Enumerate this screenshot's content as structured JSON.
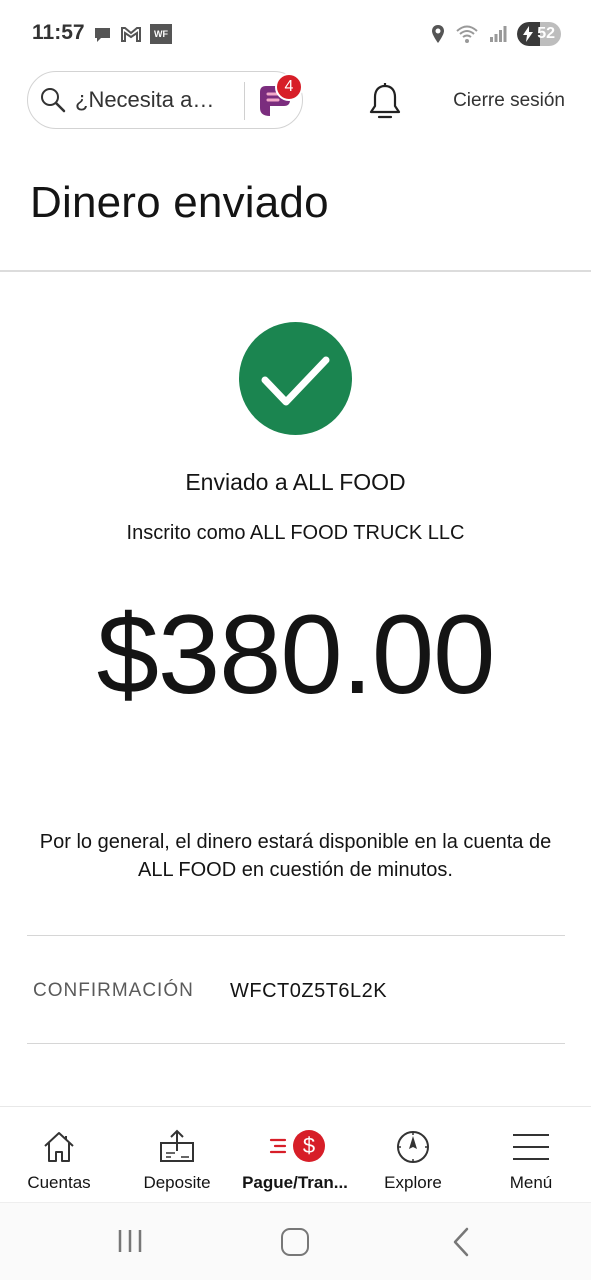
{
  "status_bar": {
    "time": "11:57",
    "wf_badge": "WF",
    "battery_level": "52",
    "icons": [
      "chat-icon",
      "gmail-icon",
      "wf-app-icon",
      "location-icon",
      "wifi-icon",
      "signal-icon",
      "battery-icon"
    ]
  },
  "header": {
    "search_placeholder": "¿Necesita a…",
    "assistant_badge_count": "4",
    "logout_label": "Cierre sesión"
  },
  "page": {
    "title": "Dinero enviado"
  },
  "confirmation": {
    "sent_to": "Enviado a ALL FOOD",
    "registered_as": "Inscrito como ALL FOOD TRUCK LLC",
    "amount": "$380.00",
    "availability_note": "Por lo general, el dinero estará disponible en la cuenta de ALL FOOD en cuestión de minutos.",
    "label": "CONFIRMACIÓN",
    "code": "WFCT0Z5T6L2K"
  },
  "tabs": [
    {
      "label": "Cuentas",
      "icon": "home-icon",
      "active": false
    },
    {
      "label": "Deposite",
      "icon": "deposit-icon",
      "active": false
    },
    {
      "label": "Pague/Tran...",
      "icon": "pay-transfer-icon",
      "active": true
    },
    {
      "label": "Explore",
      "icon": "compass-icon",
      "active": false
    },
    {
      "label": "Menú",
      "icon": "hamburger-menu-icon",
      "active": false
    }
  ],
  "colors": {
    "success_green": "#1b8550",
    "brand_red": "#d71e28",
    "fargo_purple": "#7b2d7e"
  }
}
